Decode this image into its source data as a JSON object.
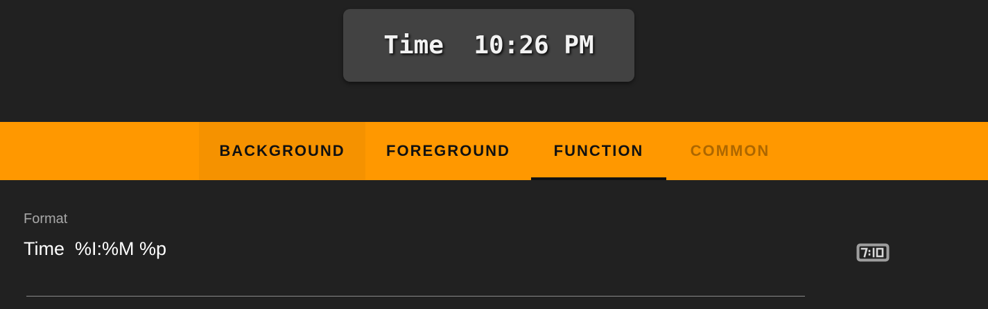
{
  "preview": {
    "text": "Time  10:26 PM"
  },
  "tabs": [
    {
      "label": "BACKGROUND",
      "state": "normal"
    },
    {
      "label": "FOREGROUND",
      "state": "normal"
    },
    {
      "label": "FUNCTION",
      "state": "selected"
    },
    {
      "label": "COMMON",
      "state": "disabled"
    }
  ],
  "format_field": {
    "label": "Format",
    "value": "Time  %I:%M %p"
  },
  "icons": {
    "format_helper": "digital-clock-icon"
  },
  "colors": {
    "background": "#212121",
    "preview_card": "#424242",
    "tab_bar": "#ff9800",
    "tab_text": "#111111",
    "indicator": "#111111",
    "label_text": "#a8a8a8",
    "value_text": "#ffffff"
  }
}
